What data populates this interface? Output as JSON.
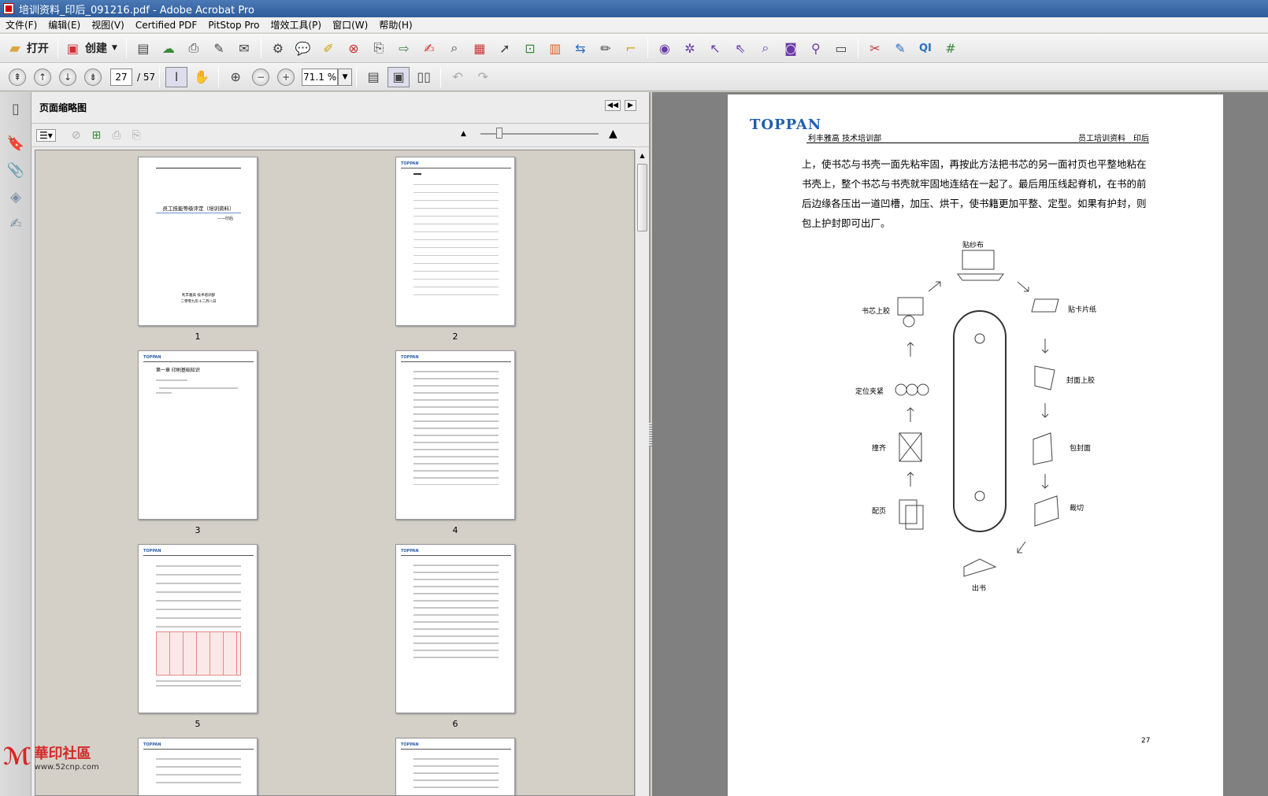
{
  "window": {
    "title": "培训资料_印后_091216.pdf - Adobe Acrobat Pro"
  },
  "menu": [
    "文件(F)",
    "编辑(E)",
    "视图(V)",
    "Certified PDF",
    "PitStop Pro",
    "增效工具(P)",
    "窗口(W)",
    "帮助(H)"
  ],
  "toolbar": {
    "open_label": "打开",
    "create_label": "创建"
  },
  "nav": {
    "current_page": "27",
    "total_pages": "/ 57",
    "zoom": "71.1 %"
  },
  "panel": {
    "title": "页面缩略图"
  },
  "thumbnails": {
    "labels": [
      "1",
      "2",
      "3",
      "4",
      "5",
      "6"
    ],
    "p1_title": "员工技能等级评定（培训资料）",
    "p1_sub": "——印后",
    "p1_footer1": "利丰雅高 技术培训部",
    "p1_footer2": "二零零九年十二月八日",
    "p3_heading": "第一章 印刷基础知识"
  },
  "document": {
    "logo": "TOPPAN",
    "header_left": "利丰雅高 技术培训部",
    "header_right": "员工培训资料　印后",
    "body": "上，使书芯与书壳一面先粘牢固，再按此方法把书芯的另一面衬页也平整地粘在书壳上，整个书芯与书壳就牢固地连结在一起了。最后用压线起脊机，在书的前后边缘各压出一道凹槽，加压、烘干，使书籍更加平整、定型。如果有护封，则包上护封即可出厂。",
    "page_number": "27",
    "diagram": {
      "labels": [
        "贴纱布",
        "贴卡片纸",
        "封面上胶",
        "包封面",
        "裁切",
        "出书",
        "配页",
        "撞齐",
        "定位夹紧",
        "书芯上胶"
      ]
    }
  },
  "watermark": {
    "main": "華印社區",
    "url": "www.52cnp.com"
  }
}
